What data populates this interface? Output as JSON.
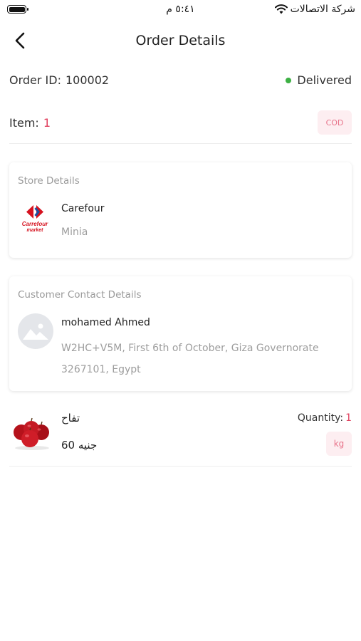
{
  "status_bar": {
    "time": "٥:٤١ م",
    "carrier": "شركة الاتصالات"
  },
  "header": {
    "title": "Order Details",
    "back_icon": "chevron-left-icon"
  },
  "order": {
    "id_label": "Order ID:",
    "id_value": "100002",
    "status": "Delivered",
    "status_color": "#3cb043",
    "item_label": "Item:",
    "item_count": "1",
    "payment_badge": "COD"
  },
  "store": {
    "section_title": "Store Details",
    "name": "Carefour",
    "city": "Minia",
    "logo_text_line1": "Carrefour",
    "logo_text_line2": "market"
  },
  "customer": {
    "section_title": "Customer Contact Details",
    "name": "mohamed Ahmed",
    "address": "W2HC+V5M, First 6th of October, Giza Governorate 3267101, Egypt",
    "avatar_icon": "image-placeholder-icon"
  },
  "product": {
    "name": "تفاح",
    "price": "60 جنيه",
    "quantity_label": "Quantity:",
    "quantity_value": "1",
    "unit": "kg",
    "image_icon": "apples-image"
  },
  "colors": {
    "accent": "#e0405e",
    "badge_bg": "#fdeef1",
    "muted_text": "#9d9d9d"
  }
}
